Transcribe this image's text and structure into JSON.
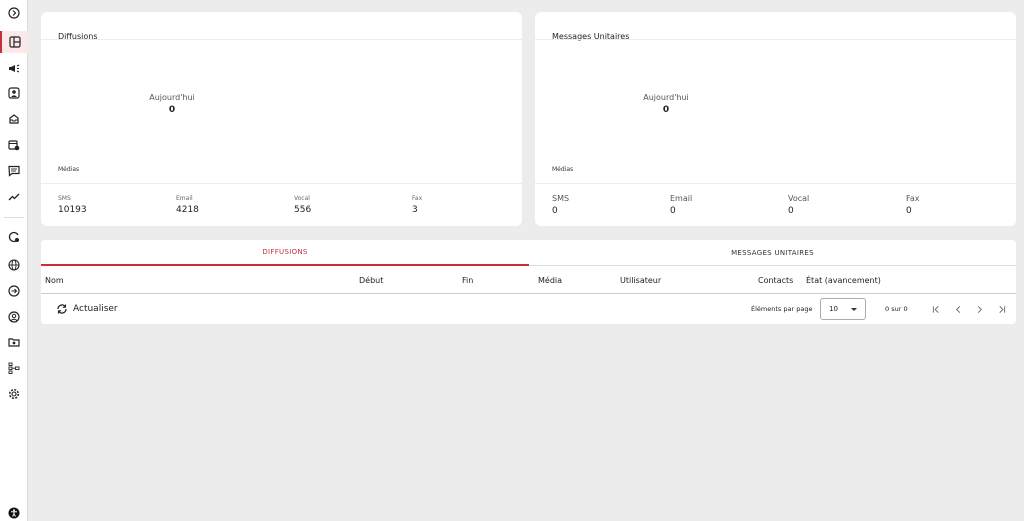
{
  "sidebar": {
    "items": [
      {
        "icon": "chevron-right-circle-icon"
      },
      {
        "icon": "dashboard-icon",
        "active": true
      },
      {
        "icon": "megaphone-icon"
      },
      {
        "icon": "contacts-icon"
      },
      {
        "icon": "inbox-icon"
      },
      {
        "icon": "calendar-icon"
      },
      {
        "icon": "message-icon"
      },
      {
        "icon": "trending-icon"
      },
      {
        "icon": "settings-gear-icon"
      },
      {
        "icon": "globe-icon"
      },
      {
        "icon": "compass-icon"
      },
      {
        "icon": "account-icon"
      },
      {
        "icon": "folder-icon"
      },
      {
        "icon": "hierarchy-icon"
      },
      {
        "icon": "gear-icon"
      },
      {
        "icon": "accessibility-icon"
      }
    ]
  },
  "cards": {
    "diffusions": {
      "title": "Diffusions",
      "today_label": "Aujourd'hui",
      "today_value": "0",
      "medias_label": "Médias",
      "stats": [
        {
          "label": "SMS",
          "value": "10193"
        },
        {
          "label": "Email",
          "value": "4218"
        },
        {
          "label": "Vocal",
          "value": "556"
        },
        {
          "label": "Fax",
          "value": "3"
        }
      ]
    },
    "messages": {
      "title": "Messages Unitaires",
      "today_label": "Aujourd'hui",
      "today_value": "0",
      "medias_label": "Médias",
      "stats": [
        {
          "label": "SMS",
          "value": "0"
        },
        {
          "label": "Email",
          "value": "0"
        },
        {
          "label": "Vocal",
          "value": "0"
        },
        {
          "label": "Fax",
          "value": "0"
        }
      ]
    }
  },
  "panel": {
    "tabs": [
      {
        "label": "DIFFUSIONS",
        "active": true
      },
      {
        "label": "MESSAGES UNITAIRES",
        "active": false
      }
    ],
    "columns": [
      "Nom",
      "Début",
      "Fin",
      "Média",
      "Utilisateur",
      "Contacts",
      "État (avancement)"
    ],
    "refresh_label": "Actualiser",
    "paginator": {
      "items_per_page_label": "Éléments par page",
      "page_size": "10",
      "range_label": "0 sur 0"
    }
  },
  "colors": {
    "accent": "#c4313a",
    "background": "#ececec"
  }
}
